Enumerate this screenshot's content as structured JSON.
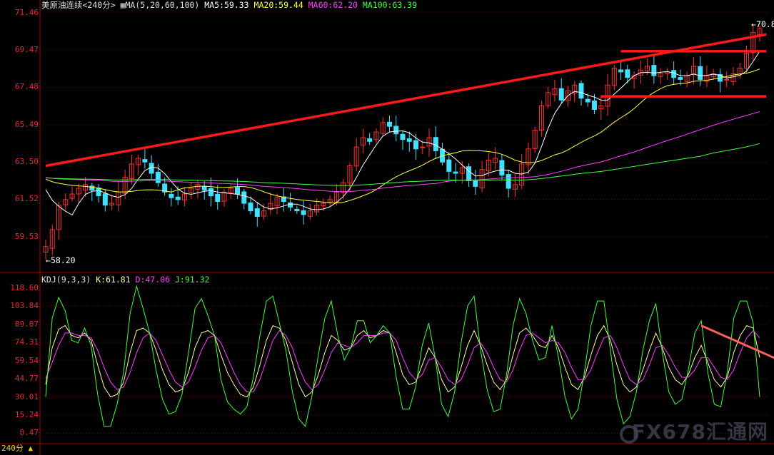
{
  "header": {
    "symbol": "美原油连续",
    "period": "<240分>",
    "ma_params": "MA(5,20,60,100)",
    "ma5": "MA5:59.33",
    "ma20": "MA20:59.44",
    "ma60": "MA60:62.20",
    "ma100": "MA100:63.39"
  },
  "kdj_header": {
    "params": "KDJ(9,3,3)",
    "k": "K:61.81",
    "d": "D:47.06",
    "j": "J:91.32"
  },
  "labels": {
    "low": "58.20",
    "high": "70.83",
    "period_tab": "240分 ▲"
  },
  "watermark": "FX678汇通网",
  "colors": {
    "up": "#ff3030",
    "down": "#40e0ff",
    "ma5": "#ffffff",
    "ma20": "#ffff40",
    "ma60": "#ff40ff",
    "ma100": "#40ff40",
    "k": "#ffffa0",
    "d": "#ff40ff",
    "j": "#40ff40",
    "trend": "#ff1a1a",
    "arrow_down": "#ff6060",
    "arrow_up": "#3090ff"
  },
  "chart_data": [
    {
      "type": "line",
      "name": "price",
      "ylim": [
        58.0,
        71.6
      ],
      "yticks": [
        "71.46",
        "69.47",
        "67.48",
        "65.49",
        "63.50",
        "61.52",
        "59.53"
      ],
      "close": [
        59.0,
        59.9,
        61.2,
        61.5,
        61.8,
        62.1,
        62.3,
        62.0,
        61.7,
        61.2,
        61.3,
        61.9,
        62.7,
        63.4,
        63.7,
        63.5,
        62.9,
        62.4,
        61.9,
        61.6,
        61.5,
        61.8,
        62.1,
        62.3,
        62.0,
        61.7,
        61.4,
        61.9,
        62.1,
        61.8,
        61.3,
        60.9,
        60.6,
        60.9,
        61.3,
        61.6,
        61.4,
        61.1,
        60.9,
        60.7,
        60.9,
        61.2,
        61.3,
        61.5,
        61.9,
        62.4,
        63.3,
        64.3,
        64.8,
        64.6,
        65.1,
        65.6,
        65.4,
        65.0,
        64.7,
        64.6,
        64.2,
        64.3,
        64.8,
        64.1,
        63.5,
        63.0,
        62.9,
        63.2,
        62.5,
        62.2,
        63.1,
        63.6,
        63.7,
        62.8,
        62.1,
        62.3,
        63.4,
        64.2,
        65.2,
        66.5,
        67.2,
        67.4,
        66.8,
        67.3,
        67.6,
        66.9,
        66.7,
        66.3,
        66.5,
        67.6,
        68.5,
        68.3,
        68.0,
        68.1,
        68.4,
        68.6,
        68.1,
        68.2,
        68.3,
        68.0,
        67.9,
        68.1,
        68.6,
        67.9,
        68.1,
        68.2,
        67.8,
        67.9,
        68.2,
        68.5,
        69.3,
        70.4,
        70.6
      ],
      "series": [
        {
          "name": "MA5",
          "period": 5
        },
        {
          "name": "MA20",
          "period": 20
        },
        {
          "name": "MA60",
          "period": 60
        },
        {
          "name": "MA100",
          "period": 100
        }
      ],
      "trendlines": [
        {
          "from": [
            0,
            63.3
          ],
          "to": [
            109,
            70.3
          ]
        },
        {
          "from": [
            87,
            69.4
          ],
          "to": [
            109,
            69.4
          ]
        },
        {
          "from": [
            84,
            67.0
          ],
          "to": [
            109,
            67.0
          ]
        }
      ]
    },
    {
      "type": "line",
      "name": "KDJ",
      "ylim": [
        -8,
        122
      ],
      "yticks": [
        "118.60",
        "103.84",
        "89.07",
        "74.31",
        "59.54",
        "44.77",
        "30.01",
        "15.24",
        "0.47"
      ],
      "series": [
        {
          "name": "K",
          "values": [
            40,
            70,
            85,
            88,
            80,
            78,
            82,
            76,
            56,
            38,
            30,
            32,
            42,
            66,
            84,
            86,
            82,
            68,
            52,
            40,
            34,
            36,
            50,
            70,
            82,
            84,
            80,
            64,
            50,
            40,
            32,
            30,
            38,
            56,
            76,
            88,
            86,
            76,
            58,
            40,
            30,
            34,
            48,
            66,
            80,
            76,
            68,
            70,
            80,
            84,
            78,
            80,
            84,
            82,
            66,
            48,
            40,
            42,
            56,
            70,
            62,
            44,
            34,
            38,
            54,
            72,
            84,
            72,
            56,
            42,
            36,
            44,
            64,
            82,
            86,
            80,
            72,
            70,
            80,
            70,
            54,
            40,
            36,
            46,
            64,
            80,
            88,
            76,
            56,
            40,
            34,
            38,
            52,
            68,
            82,
            70,
            54,
            44,
            40,
            48,
            62,
            72,
            58,
            44,
            38,
            46,
            66,
            80,
            88,
            86,
            62
          ]
        },
        {
          "name": "D",
          "values": [
            45,
            58,
            72,
            82,
            82,
            80,
            80,
            78,
            68,
            54,
            42,
            36,
            38,
            50,
            66,
            78,
            82,
            76,
            64,
            52,
            42,
            38,
            42,
            54,
            68,
            78,
            80,
            74,
            62,
            50,
            40,
            34,
            34,
            44,
            60,
            76,
            84,
            80,
            70,
            54,
            42,
            36,
            40,
            52,
            66,
            74,
            72,
            70,
            74,
            80,
            80,
            80,
            82,
            82,
            76,
            62,
            50,
            44,
            48,
            60,
            62,
            54,
            44,
            40,
            44,
            56,
            70,
            74,
            66,
            54,
            44,
            42,
            52,
            68,
            80,
            82,
            78,
            74,
            76,
            74,
            66,
            54,
            44,
            44,
            52,
            66,
            78,
            80,
            70,
            56,
            44,
            40,
            44,
            56,
            70,
            72,
            64,
            54,
            46,
            46,
            52,
            62,
            62,
            54,
            46,
            44,
            52,
            66,
            78,
            84,
            78
          ]
        },
        {
          "name": "J",
          "values": [
            30,
            94,
            111,
            100,
            76,
            74,
            86,
            72,
            32,
            6,
            6,
            24,
            50,
            98,
            120,
            102,
            82,
            52,
            28,
            16,
            18,
            32,
            66,
            102,
            110,
            96,
            80,
            44,
            26,
            20,
            16,
            22,
            46,
            80,
            108,
            112,
            90,
            68,
            34,
            12,
            6,
            30,
            64,
            94,
            108,
            80,
            60,
            70,
            92,
            92,
            74,
            80,
            88,
            82,
            46,
            20,
            20,
            38,
            72,
            90,
            62,
            24,
            14,
            34,
            74,
            104,
            112,
            68,
            36,
            18,
            20,
            48,
            88,
            110,
            98,
            76,
            60,
            62,
            88,
            62,
            30,
            12,
            20,
            50,
            88,
            108,
            108,
            68,
            28,
            8,
            14,
            34,
            68,
            92,
            106,
            66,
            34,
            24,
            28,
            52,
            82,
            92,
            50,
            24,
            22,
            50,
            94,
            108,
            108,
            90,
            30
          ]
        }
      ],
      "arrows": [
        {
          "from": [
            101,
            88
          ],
          "to": [
            119,
            46
          ]
        },
        {
          "from": [
            119,
            46
          ],
          "to": [
            121,
            100
          ]
        }
      ]
    }
  ]
}
